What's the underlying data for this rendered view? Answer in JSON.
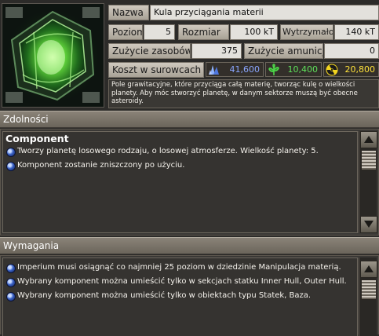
{
  "info": {
    "name_label": "Nazwa",
    "name_value": "Kula przyciągania materii",
    "level_label": "Poziom",
    "level_value": "5",
    "size_label": "Rozmiar",
    "size_value": "100 kT",
    "durability_label": "Wytrzymałość",
    "durability_value": "140 kT",
    "resource_use_label": "Zużycie zasobów",
    "resource_use_value": "375",
    "ammo_use_label": "Zużycie amunicji",
    "ammo_use_value": "0",
    "cost_label": "Koszt w surowcach",
    "costs": [
      {
        "icon": "crystal-icon",
        "value": "41,600",
        "color": "#8aa6ff"
      },
      {
        "icon": "plant-icon",
        "value": "10,400",
        "color": "#5ee05a"
      },
      {
        "icon": "radiation-icon",
        "value": "20,800",
        "color": "#ffe23a"
      }
    ],
    "description": "Pole grawitacyjne, które przyciąga całą materię, tworząc kulę o wielkości planety.  Aby móc stworzyć planetę, w danym sektorze muszą być obecne asteroidy."
  },
  "abilities": {
    "header": "Zdolności",
    "component_title": "Component",
    "items": [
      "Tworzy planetę losowego rodzaju, o losowej atmosferze. Wielkość planety: 5.",
      "Komponent zostanie zniszczony po użyciu."
    ]
  },
  "requirements": {
    "header": "Wymagania",
    "items": [
      "Imperium musi osiągnąć co najmniej 25 poziom w dziedzinie Manipulacja materią.",
      "Wybrany komponent można umieścić tylko w sekcjach statku Inner Hull, Outer Hull.",
      "Wybrany komponent można umieścić tylko w obiektach typu Statek, Baza."
    ]
  }
}
